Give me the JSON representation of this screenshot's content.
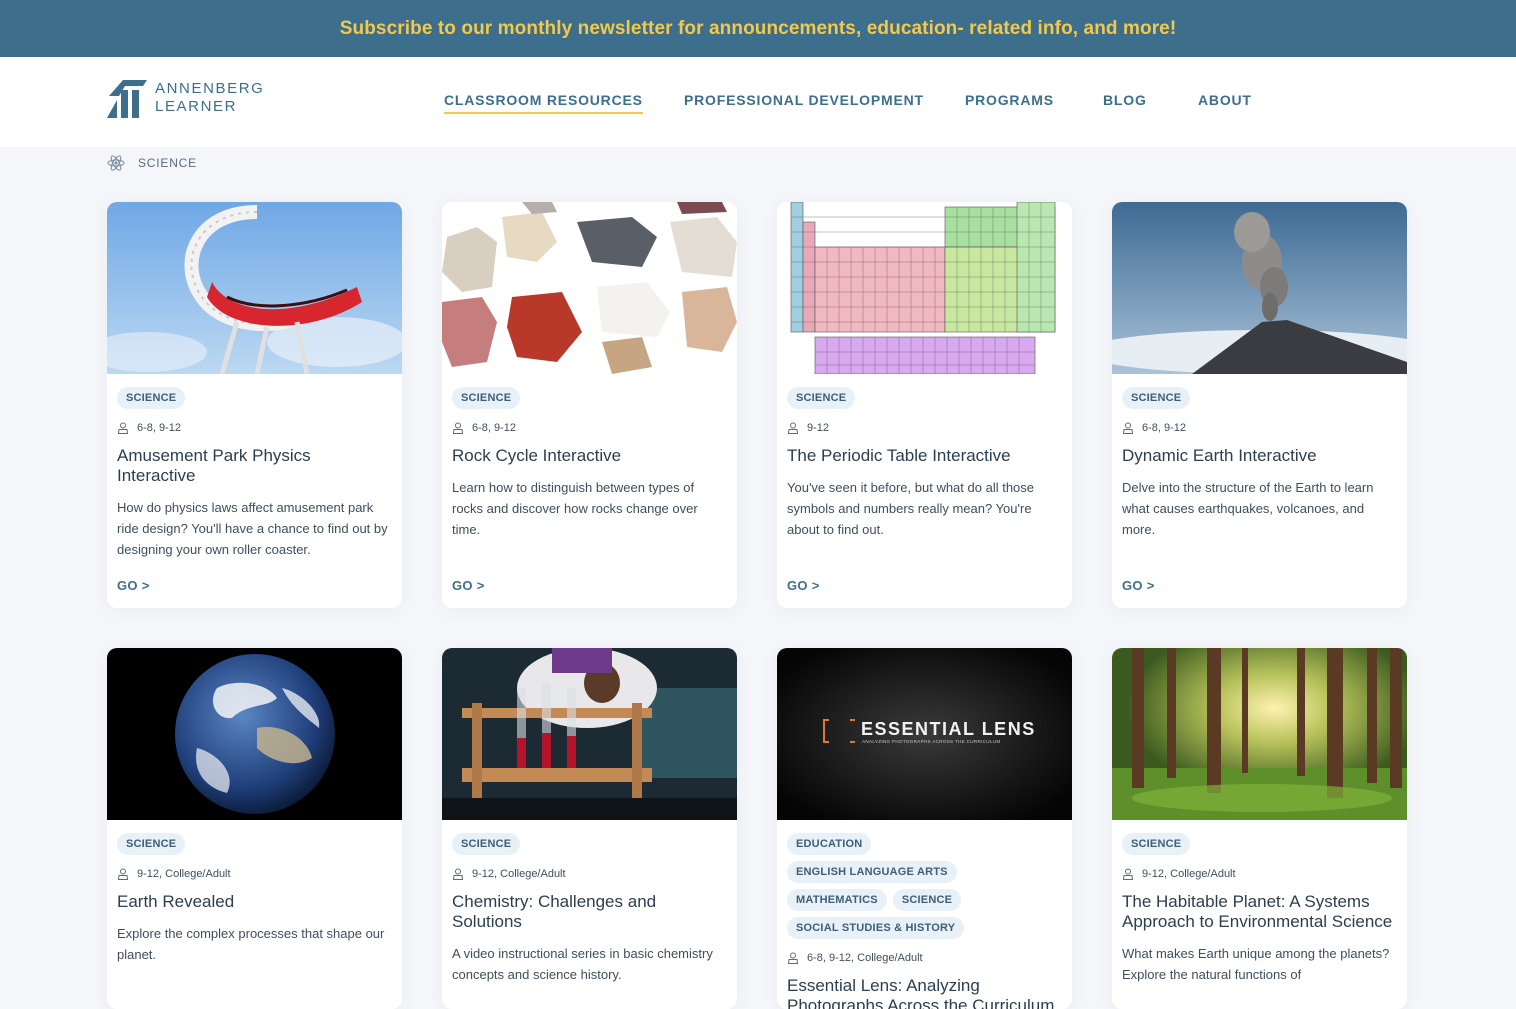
{
  "banner": {
    "text": "Subscribe to our monthly newsletter for announcements, education- related info, and more!",
    "text_color": "#f2c94c",
    "background": "#3d6f8c"
  },
  "logo": {
    "line1": "ANNENBERG",
    "line2": "LEARNER"
  },
  "nav": {
    "items": [
      {
        "label": "CLASSROOM RESOURCES",
        "active": true
      },
      {
        "label": "PROFESSIONAL DEVELOPMENT",
        "active": false
      },
      {
        "label": "PROGRAMS",
        "active": false
      },
      {
        "label": "BLOG",
        "active": false
      },
      {
        "label": "ABOUT",
        "active": false
      }
    ]
  },
  "breadcrumb": {
    "icon": "atom-icon",
    "label": "SCIENCE"
  },
  "cards": [
    {
      "image": "roller-coaster-image",
      "tags": [
        "SCIENCE"
      ],
      "grades": "6-8, 9-12",
      "title": "Amusement Park Physics Interactive",
      "description": "How do physics laws affect amusement park ride design? You'll have a chance to find out by designing your own roller coaster.",
      "link": "GO >"
    },
    {
      "image": "rocks-image",
      "tags": [
        "SCIENCE"
      ],
      "grades": "6-8, 9-12",
      "title": "Rock Cycle Interactive",
      "description": "Learn how to distinguish between types of rocks and discover how rocks change over time.",
      "link": "GO >"
    },
    {
      "image": "periodic-table-image",
      "tags": [
        "SCIENCE"
      ],
      "grades": "9-12",
      "title": "The Periodic Table Interactive",
      "description": "You've seen it before, but what do all those symbols and numbers really mean? You're about to find out.",
      "link": "GO >"
    },
    {
      "image": "volcano-image",
      "tags": [
        "SCIENCE"
      ],
      "grades": "6-8, 9-12",
      "title": "Dynamic Earth Interactive",
      "description": "Delve into the structure of the Earth to learn what causes earthquakes, volcanoes, and more.",
      "link": "GO >"
    },
    {
      "image": "earth-image",
      "tags": [
        "SCIENCE"
      ],
      "grades": "9-12, College/Adult",
      "title": "Earth Revealed",
      "description": "Explore the complex processes that shape our planet."
    },
    {
      "image": "chemistry-lab-image",
      "tags": [
        "SCIENCE"
      ],
      "grades": "9-12, College/Adult",
      "title": "Chemistry: Challenges and Solutions",
      "description": "A video instructional series in basic chemistry concepts and science history."
    },
    {
      "image": "essential-lens-image",
      "image_text": "ESSENTIAL LENS",
      "image_subtext": "ANALYZING PHOTOGRAPHS ACROSS THE CURRICULUM",
      "tags": [
        "EDUCATION",
        "ENGLISH LANGUAGE ARTS",
        "MATHEMATICS",
        "SCIENCE",
        "SOCIAL STUDIES & HISTORY"
      ],
      "grades": "6-8, 9-12, College/Adult",
      "title": "Essential Lens: Analyzing Photographs Across the Curriculum",
      "description": ""
    },
    {
      "image": "forest-image",
      "tags": [
        "SCIENCE"
      ],
      "grades": "9-12, College/Adult",
      "title": "The Habitable Planet: A Systems Approach to Environmental Science",
      "description": "What makes Earth unique among the planets? Explore the natural functions of"
    }
  ]
}
